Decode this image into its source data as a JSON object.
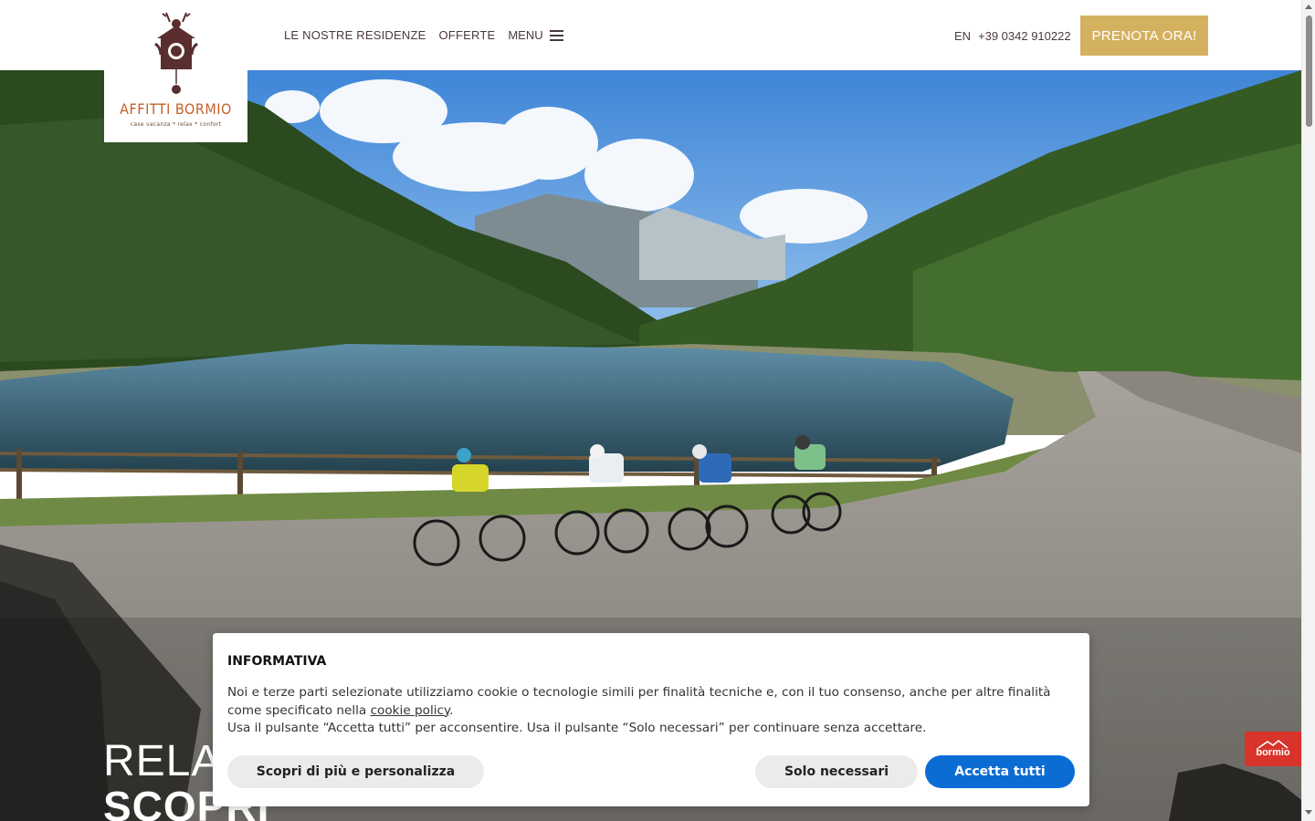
{
  "brand": {
    "name": "AFFITTI BORMIO",
    "tagline": "case vacanza * relax * confort"
  },
  "nav": {
    "residences": "LE NOSTRE RESIDENZE",
    "offers": "OFFERTE",
    "menu": "MENU"
  },
  "header": {
    "language": "EN",
    "phone": "+39 0342 910222",
    "book_label": "PRENOTA ORA!"
  },
  "hero": {
    "line1": "RELAX",
    "line2": "SCOPRI"
  },
  "badge": {
    "label": "bormio"
  },
  "cookie": {
    "title": "INFORMATIVA",
    "text_before_link": "Noi e terze parti selezionate utilizziamo cookie o tecnologie simili per finalità tecniche e, con il tuo consenso, anche per altre finalità come specificato nella ",
    "link_label": "cookie policy",
    "text_after_link": ".",
    "text_line2": "Usa il pulsante “Accetta tutti” per acconsentire. Usa il pulsante “Solo necessari” per continuare senza accettare.",
    "more_button": "Scopri di più e personalizza",
    "necessary_button": "Solo necessari",
    "accept_button": "Accetta tutti"
  },
  "colors": {
    "accent_gold": "#d4b15f",
    "logo_orange": "#c2602a",
    "primary_blue": "#0b6cd4",
    "badge_red": "#d8342b"
  }
}
